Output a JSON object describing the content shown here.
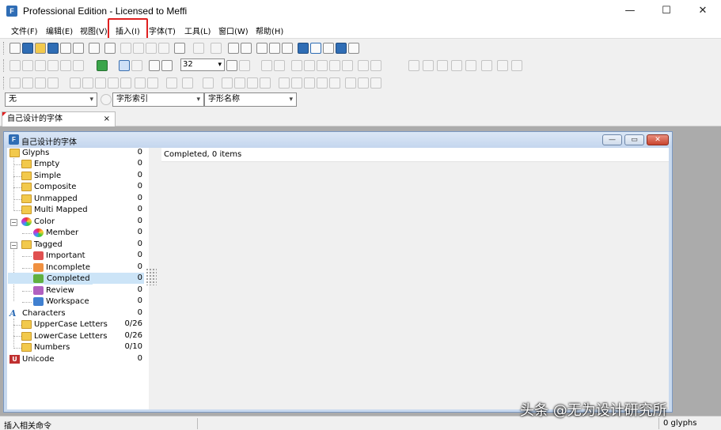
{
  "window": {
    "title": "Professional Edition - Licensed to Meffi",
    "app_icon": "F",
    "minimize": "—",
    "maximize": "☐",
    "close": "✕"
  },
  "menu": {
    "items": [
      "文件(F)",
      "编辑(E)",
      "视图(V)",
      "插入(I)",
      "字体(T)",
      "工具(L)",
      "窗口(W)",
      "帮助(H)"
    ],
    "highlighted": "插入(I)",
    "highlight_color": "#e02020"
  },
  "toolbar": {
    "zoom_value": "32",
    "combo_1": "无",
    "combo_2": "字形索引",
    "combo_3": "字形名称"
  },
  "document_tab": {
    "label": "自己设计的字体",
    "close": "×"
  },
  "child_window": {
    "title": "自己设计的字体",
    "icon": "F",
    "minimize": "—",
    "restore": "▭",
    "close": "✕"
  },
  "tree": {
    "glyphs": {
      "label": "Glyphs",
      "count": "0"
    },
    "empty": {
      "label": "Empty",
      "count": "0"
    },
    "simple": {
      "label": "Simple",
      "count": "0"
    },
    "composite": {
      "label": "Composite",
      "count": "0"
    },
    "unmapped": {
      "label": "Unmapped",
      "count": "0"
    },
    "multi_mapped": {
      "label": "Multi Mapped",
      "count": "0"
    },
    "color": {
      "label": "Color",
      "count": "0"
    },
    "member": {
      "label": "Member",
      "count": "0"
    },
    "tagged": {
      "label": "Tagged",
      "count": "0"
    },
    "important": {
      "label": "Important",
      "count": "0"
    },
    "incomplete": {
      "label": "Incomplete",
      "count": "0"
    },
    "completed": {
      "label": "Completed",
      "count": "0"
    },
    "review": {
      "label": "Review",
      "count": "0"
    },
    "workspace": {
      "label": "Workspace",
      "count": "0"
    },
    "characters": {
      "label": "Characters",
      "count": "0"
    },
    "uppercase": {
      "label": "UpperCase Letters",
      "count": "0/26"
    },
    "lowercase": {
      "label": "LowerCase Letters",
      "count": "0/26"
    },
    "numbers": {
      "label": "Numbers",
      "count": "0/10"
    },
    "unicode": {
      "label": "Unicode",
      "count": "0"
    },
    "selected": "Completed"
  },
  "content": {
    "status": "Completed, 0 items"
  },
  "statusbar": {
    "left": "插入相关命令",
    "right": "0 glyphs"
  },
  "watermark": {
    "text": "头条 @无为设计研究所"
  }
}
